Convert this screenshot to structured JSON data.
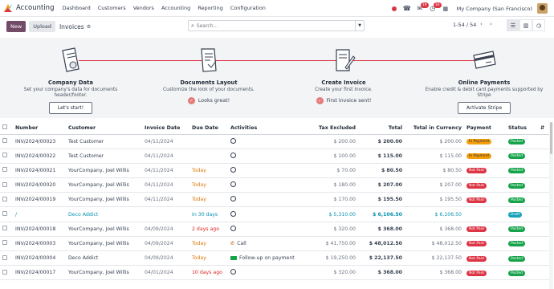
{
  "topbar": {
    "app_name": "Accounting",
    "menu": [
      "Dashboard",
      "Customers",
      "Vendors",
      "Accounting",
      "Reporting",
      "Configuration"
    ],
    "company": "My Company (San Francisco)",
    "badge_chat": "19",
    "badge_activity": "16"
  },
  "control": {
    "new_label": "New",
    "upload_label": "Upload",
    "breadcrumb": "Invoices",
    "search_placeholder": "Search...",
    "pager": "1-54 / 54"
  },
  "onboarding": [
    {
      "title": "Company Data",
      "desc": "Set your company's data for documents header/footer.",
      "button": "Let's start!",
      "done": ""
    },
    {
      "title": "Documents Layout",
      "desc": "Customize the look of your documents.",
      "button": "",
      "done": "Looks great!"
    },
    {
      "title": "Create Invoice",
      "desc": "Create your first invoice.",
      "button": "",
      "done": "First invoice sent!"
    },
    {
      "title": "Online Payments",
      "desc": "Enable credit & debit card payments supported by Stripe",
      "button": "Activate Stripe",
      "done": ""
    }
  ],
  "table": {
    "headers": [
      "Number",
      "Customer",
      "Invoice Date",
      "Due Date",
      "Activities",
      "Tax Excluded",
      "Total",
      "Total in Currency",
      "Payment",
      "Status"
    ],
    "rows": [
      {
        "number": "INV/2024/00023",
        "customer": "Test Customer",
        "invoice_date": "04/11/2024",
        "due_date": "",
        "due_class": "",
        "activity": "",
        "tax_excluded": "$ 200.00",
        "total": "$ 200.00",
        "total_currency": "$ 200.00",
        "payment": "In Payment",
        "payment_class": "inpay",
        "status": "Posted",
        "status_class": "posted"
      },
      {
        "number": "INV/2024/00022",
        "customer": "Test Customer",
        "invoice_date": "04/11/2024",
        "due_date": "",
        "due_class": "",
        "activity": "",
        "tax_excluded": "$ 100.00",
        "total": "$ 115.00",
        "total_currency": "$ 115.00",
        "payment": "In Payment",
        "payment_class": "inpay",
        "status": "Posted",
        "status_class": "posted"
      },
      {
        "number": "INV/2024/00021",
        "customer": "YourCompany, Joel Willis",
        "invoice_date": "04/11/2024",
        "due_date": "Today",
        "due_class": "orange",
        "activity": "",
        "tax_excluded": "$ 70.00",
        "total": "$ 80.50",
        "total_currency": "$ 80.50",
        "payment": "Not Paid",
        "payment_class": "notpaid",
        "status": "Posted",
        "status_class": "posted"
      },
      {
        "number": "INV/2024/00020",
        "customer": "YourCompany, Joel Willis",
        "invoice_date": "04/11/2024",
        "due_date": "Today",
        "due_class": "orange",
        "activity": "",
        "tax_excluded": "$ 180.00",
        "total": "$ 207.00",
        "total_currency": "$ 207.00",
        "payment": "Not Paid",
        "payment_class": "notpaid",
        "status": "Posted",
        "status_class": "posted"
      },
      {
        "number": "INV/2024/00019",
        "customer": "YourCompany, Joel Willis",
        "invoice_date": "04/11/2024",
        "due_date": "Today",
        "due_class": "orange",
        "activity": "",
        "tax_excluded": "$ 170.00",
        "total": "$ 195.50",
        "total_currency": "$ 195.50",
        "payment": "Not Paid",
        "payment_class": "notpaid",
        "status": "Posted",
        "status_class": "posted"
      },
      {
        "number": "/",
        "customer": "Deco Addict",
        "invoice_date": "",
        "due_date": "In 30 days",
        "due_class": "blue",
        "activity": "",
        "tax_excluded": "$ 5,310.00",
        "total": "$ 6,106.50",
        "total_currency": "$ 6,106.50",
        "payment": "",
        "payment_class": "",
        "status": "Draft",
        "status_class": "draft",
        "draft": true
      },
      {
        "number": "INV/2024/00018",
        "customer": "YourCompany, Joel Willis",
        "invoice_date": "04/09/2024",
        "due_date": "2 days ago",
        "due_class": "red",
        "activity": "",
        "tax_excluded": "$ 320.00",
        "total": "$ 368.00",
        "total_currency": "$ 368.00",
        "payment": "Not Paid",
        "payment_class": "notpaid",
        "status": "Posted",
        "status_class": "posted"
      },
      {
        "number": "INV/2024/00003",
        "customer": "YourCompany, Joel Willis",
        "invoice_date": "04/09/2024",
        "due_date": "Today",
        "due_class": "orange",
        "activity": "Call",
        "activity_icon": "phone",
        "tax_excluded": "$ 41,750.00",
        "total": "$ 48,012.50",
        "total_currency": "$ 48,012.50",
        "payment": "Not Paid",
        "payment_class": "notpaid",
        "status": "Posted",
        "status_class": "posted"
      },
      {
        "number": "INV/2024/00004",
        "customer": "Deco Addict",
        "invoice_date": "04/09/2024",
        "due_date": "Today",
        "due_class": "orange",
        "activity": "Follow-up on payment",
        "activity_icon": "money",
        "tax_excluded": "$ 19,250.00",
        "total": "$ 22,137.50",
        "total_currency": "$ 22,137.50",
        "payment": "Not Paid",
        "payment_class": "notpaid",
        "status": "Posted",
        "status_class": "posted"
      },
      {
        "number": "INV/2024/00017",
        "customer": "YourCompany, Joel Willis",
        "invoice_date": "04/01/2024",
        "due_date": "10 days ago",
        "due_class": "red",
        "activity": "",
        "tax_excluded": "$ 320.00",
        "total": "$ 368.00",
        "total_currency": "$ 368.00",
        "payment": "Not Paid",
        "payment_class": "notpaid",
        "status": "Posted",
        "status_class": "posted"
      }
    ]
  }
}
